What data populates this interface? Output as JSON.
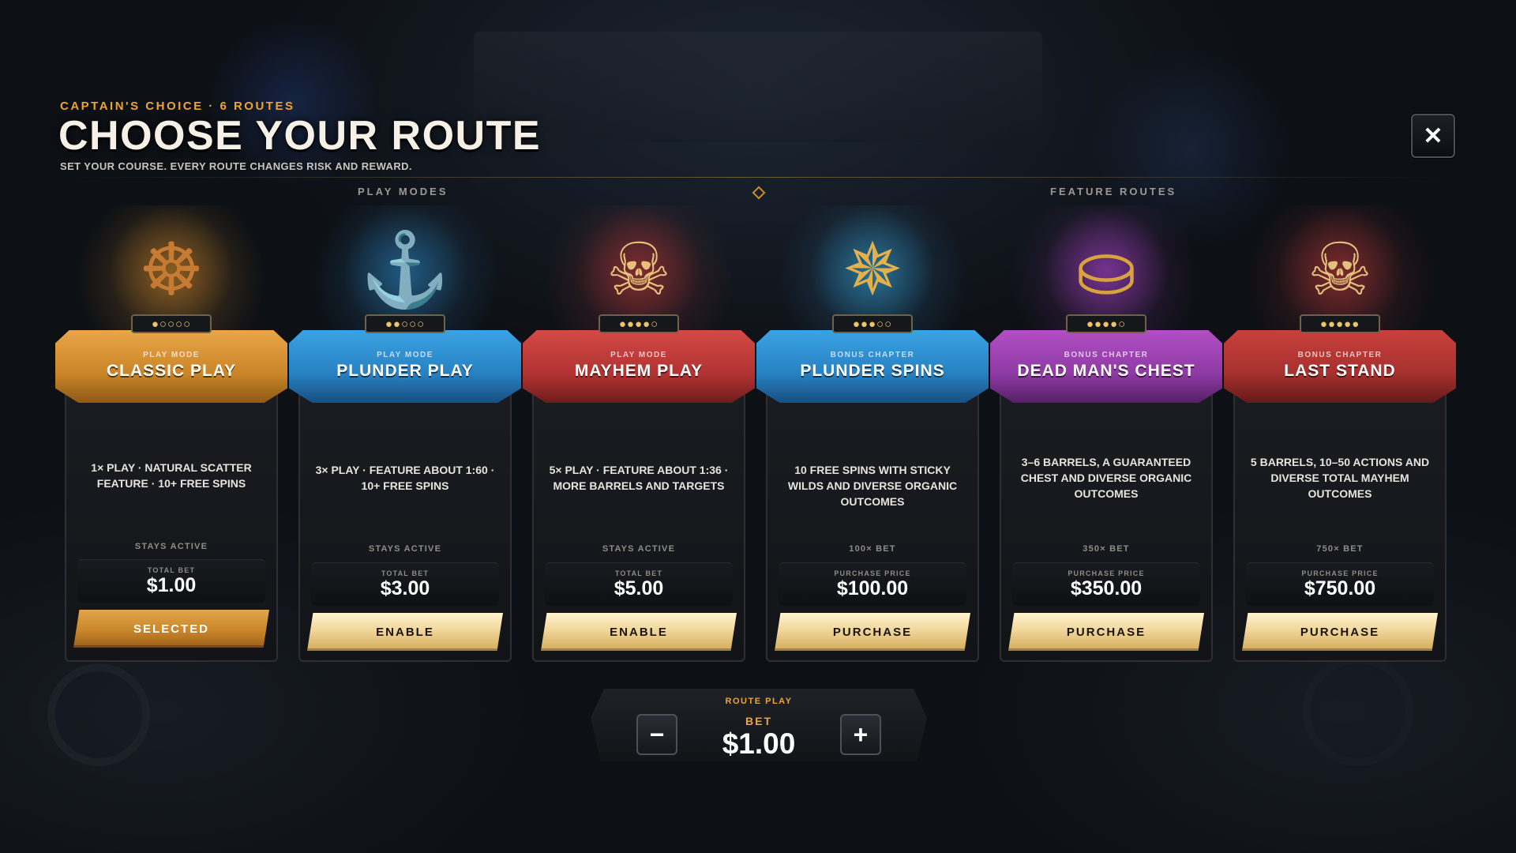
{
  "header": {
    "kicker": "CAPTAIN'S CHOICE · 6 ROUTES",
    "title": "CHOOSE YOUR ROUTE",
    "subtitle": "SET YOUR COURSE. EVERY ROUTE CHANGES RISK AND REWARD.",
    "close_icon": "close-icon"
  },
  "sections": {
    "left": "PLAY MODES",
    "right": "FEATURE ROUTES"
  },
  "cards": [
    {
      "kicker": "PLAY MODE",
      "name": "CLASSIC PLAY",
      "desc": "1× PLAY · NATURAL SCATTER FEATURE · 10+ FREE SPINS",
      "status": "STAYS ACTIVE",
      "price_label": "TOTAL BET",
      "price": "$1.00",
      "button": "SELECTED",
      "pips": "●○○○○",
      "icon": "ship-wheel-cutlass-icon",
      "color": "#d0892b"
    },
    {
      "kicker": "PLAY MODE",
      "name": "PLUNDER PLAY",
      "desc": "3× PLAY · FEATURE ABOUT 1:60 · 10+ FREE SPINS",
      "status": "STAYS ACTIVE",
      "price_label": "TOTAL BET",
      "price": "$3.00",
      "button": "ENABLE",
      "pips": "●●○○○",
      "icon": "anchor-gold-coins-icon",
      "color": "#2f8fd1"
    },
    {
      "kicker": "PLAY MODE",
      "name": "MAYHEM PLAY",
      "desc": "5× PLAY · FEATURE ABOUT 1:36 · MORE BARRELS AND TARGETS",
      "status": "STAYS ACTIVE",
      "price_label": "TOTAL BET",
      "price": "$5.00",
      "button": "ENABLE",
      "pips": "●●●●○",
      "icon": "skull-bomb-icon",
      "color": "#c23a3a"
    },
    {
      "kicker": "BONUS CHAPTER",
      "name": "PLUNDER SPINS",
      "desc": "10 FREE SPINS WITH STICKY WILDS AND DIVERSE ORGANIC OUTCOMES",
      "status": "100× BET",
      "price_label": "PURCHASE PRICE",
      "price": "$100.00",
      "button": "PURCHASE",
      "pips": "●●●○○",
      "icon": "compass-wheel-icon",
      "color": "#2f8fd1"
    },
    {
      "kicker": "BONUS CHAPTER",
      "name": "DEAD MAN'S CHEST",
      "desc": "3–6 BARRELS, A GUARANTEED CHEST AND DIVERSE ORGANIC OUTCOMES",
      "status": "350× BET",
      "price_label": "PURCHASE PRICE",
      "price": "$350.00",
      "button": "PURCHASE",
      "pips": "●●●●○",
      "icon": "treasure-chest-icon",
      "color": "#9b3fb0"
    },
    {
      "kicker": "BONUS CHAPTER",
      "name": "LAST STAND",
      "desc": "5 BARRELS, 10–50 ACTIONS AND DIVERSE TOTAL MAYHEM OUTCOMES",
      "status": "750× BET",
      "price_label": "PURCHASE PRICE",
      "price": "$750.00",
      "button": "PURCHASE",
      "pips": "●●●●●",
      "icon": "pirate-skull-icon",
      "color": "#c23a3a"
    }
  ],
  "bet": {
    "kicker": "ROUTE PLAY",
    "label": "BET",
    "value": "$1.00",
    "minus": "−",
    "plus": "+"
  }
}
